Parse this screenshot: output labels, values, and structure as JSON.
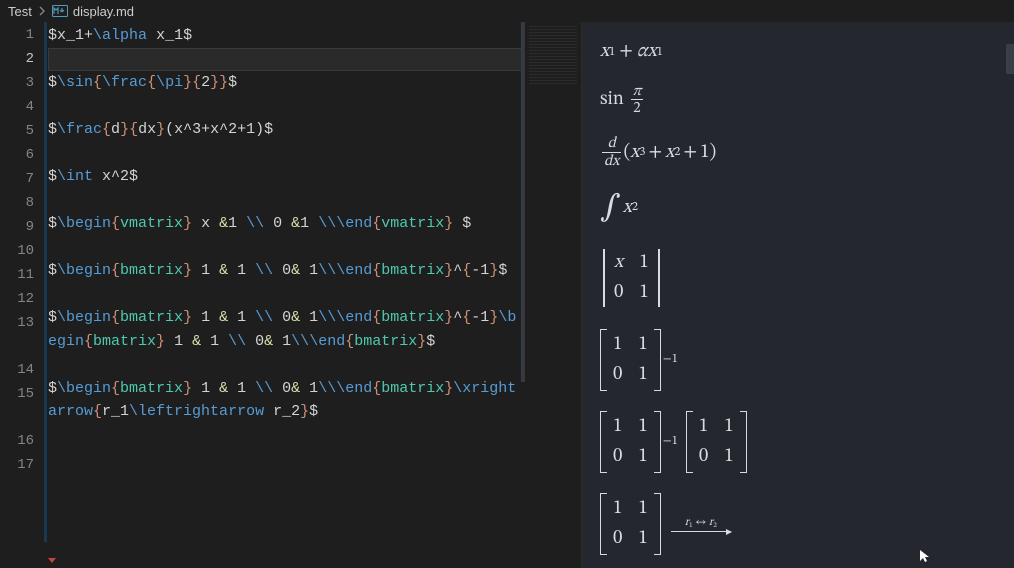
{
  "breadcrumb": {
    "root": "Test",
    "file": "display.md",
    "icon_name": "markdown-file-icon"
  },
  "editor": {
    "active_line": 2,
    "lines": [
      {
        "n": 1,
        "kind": "code",
        "segments": [
          {
            "t": "$",
            "c": "tk-white"
          },
          {
            "t": "x_1",
            "c": "tk-white"
          },
          {
            "t": "+",
            "c": "tk-white"
          },
          {
            "t": "\\alpha",
            "c": "tk-key"
          },
          {
            "t": " x_1",
            "c": "tk-white"
          },
          {
            "t": "$",
            "c": "tk-white"
          }
        ]
      },
      {
        "n": 2,
        "kind": "blank",
        "segments": []
      },
      {
        "n": 3,
        "kind": "code",
        "segments": [
          {
            "t": "$",
            "c": "tk-white"
          },
          {
            "t": "\\sin",
            "c": "tk-key"
          },
          {
            "t": "{",
            "c": "tk-orange"
          },
          {
            "t": "\\frac",
            "c": "tk-key"
          },
          {
            "t": "{",
            "c": "tk-orange"
          },
          {
            "t": "\\pi",
            "c": "tk-key"
          },
          {
            "t": "}{",
            "c": "tk-orange"
          },
          {
            "t": "2",
            "c": "tk-white"
          },
          {
            "t": "}}",
            "c": "tk-orange"
          },
          {
            "t": "$",
            "c": "tk-white"
          }
        ]
      },
      {
        "n": 4,
        "kind": "blank",
        "segments": []
      },
      {
        "n": 5,
        "kind": "code",
        "segments": [
          {
            "t": "$",
            "c": "tk-white"
          },
          {
            "t": "\\frac",
            "c": "tk-key"
          },
          {
            "t": "{",
            "c": "tk-orange"
          },
          {
            "t": "d",
            "c": "tk-white"
          },
          {
            "t": "}{",
            "c": "tk-orange"
          },
          {
            "t": "dx",
            "c": "tk-white"
          },
          {
            "t": "}",
            "c": "tk-orange"
          },
          {
            "t": "(x^3+x^2+1)",
            "c": "tk-white"
          },
          {
            "t": "$",
            "c": "tk-white"
          }
        ]
      },
      {
        "n": 6,
        "kind": "blank",
        "segments": []
      },
      {
        "n": 7,
        "kind": "code",
        "segments": [
          {
            "t": "$",
            "c": "tk-white"
          },
          {
            "t": "\\int",
            "c": "tk-key"
          },
          {
            "t": " x^2",
            "c": "tk-white"
          },
          {
            "t": "$",
            "c": "tk-white"
          }
        ]
      },
      {
        "n": 8,
        "kind": "blank",
        "segments": []
      },
      {
        "n": 9,
        "kind": "code",
        "segments": [
          {
            "t": "$",
            "c": "tk-white"
          },
          {
            "t": "\\begin",
            "c": "tk-key"
          },
          {
            "t": "{",
            "c": "tk-orange"
          },
          {
            "t": "vmatrix",
            "c": "tk-green"
          },
          {
            "t": "}",
            "c": "tk-orange"
          },
          {
            "t": " x ",
            "c": "tk-white"
          },
          {
            "t": "&",
            "c": "tk-yellow"
          },
          {
            "t": "1 ",
            "c": "tk-white"
          },
          {
            "t": "\\\\",
            "c": "tk-key"
          },
          {
            "t": " 0 ",
            "c": "tk-white"
          },
          {
            "t": "&",
            "c": "tk-yellow"
          },
          {
            "t": "1 ",
            "c": "tk-white"
          },
          {
            "t": "\\\\",
            "c": "tk-key"
          },
          {
            "t": "\\end",
            "c": "tk-key"
          },
          {
            "t": "{",
            "c": "tk-orange"
          },
          {
            "t": "vmatrix",
            "c": "tk-green"
          },
          {
            "t": "}",
            "c": "tk-orange"
          },
          {
            "t": " $",
            "c": "tk-white"
          }
        ]
      },
      {
        "n": 10,
        "kind": "blank",
        "segments": []
      },
      {
        "n": 11,
        "kind": "code",
        "segments": [
          {
            "t": "$",
            "c": "tk-white"
          },
          {
            "t": "\\begin",
            "c": "tk-key"
          },
          {
            "t": "{",
            "c": "tk-orange"
          },
          {
            "t": "bmatrix",
            "c": "tk-green"
          },
          {
            "t": "}",
            "c": "tk-orange"
          },
          {
            "t": " 1 ",
            "c": "tk-white"
          },
          {
            "t": "&",
            "c": "tk-yellow"
          },
          {
            "t": " 1 ",
            "c": "tk-white"
          },
          {
            "t": "\\\\",
            "c": "tk-key"
          },
          {
            "t": " 0",
            "c": "tk-white"
          },
          {
            "t": "&",
            "c": "tk-yellow"
          },
          {
            "t": " 1",
            "c": "tk-white"
          },
          {
            "t": "\\\\",
            "c": "tk-key"
          },
          {
            "t": "\\end",
            "c": "tk-key"
          },
          {
            "t": "{",
            "c": "tk-orange"
          },
          {
            "t": "bmatrix",
            "c": "tk-green"
          },
          {
            "t": "}",
            "c": "tk-orange"
          },
          {
            "t": "^",
            "c": "tk-white"
          },
          {
            "t": "{",
            "c": "tk-orange"
          },
          {
            "t": "-1",
            "c": "tk-white"
          },
          {
            "t": "}",
            "c": "tk-orange"
          },
          {
            "t": "$",
            "c": "tk-white"
          }
        ]
      },
      {
        "n": 12,
        "kind": "blank",
        "segments": []
      },
      {
        "n": 13,
        "kind": "code",
        "segments": [
          {
            "t": "$",
            "c": "tk-white"
          },
          {
            "t": "\\begin",
            "c": "tk-key"
          },
          {
            "t": "{",
            "c": "tk-orange"
          },
          {
            "t": "bmatrix",
            "c": "tk-green"
          },
          {
            "t": "}",
            "c": "tk-orange"
          },
          {
            "t": " 1 ",
            "c": "tk-white"
          },
          {
            "t": "&",
            "c": "tk-yellow"
          },
          {
            "t": " 1 ",
            "c": "tk-white"
          },
          {
            "t": "\\\\",
            "c": "tk-key"
          },
          {
            "t": " 0",
            "c": "tk-white"
          },
          {
            "t": "&",
            "c": "tk-yellow"
          },
          {
            "t": " 1",
            "c": "tk-white"
          },
          {
            "t": "\\\\",
            "c": "tk-key"
          },
          {
            "t": "\\end",
            "c": "tk-key"
          },
          {
            "t": "{",
            "c": "tk-orange"
          },
          {
            "t": "bmatrix",
            "c": "tk-green"
          },
          {
            "t": "}",
            "c": "tk-orange"
          },
          {
            "t": "^",
            "c": "tk-white"
          },
          {
            "t": "{",
            "c": "tk-orange"
          },
          {
            "t": "-1",
            "c": "tk-white"
          },
          {
            "t": "}",
            "c": "tk-orange"
          },
          {
            "t": "\\begin",
            "c": "tk-key"
          },
          {
            "t": "{",
            "c": "tk-orange"
          },
          {
            "t": "bmatrix",
            "c": "tk-green"
          },
          {
            "t": "}",
            "c": "tk-orange"
          },
          {
            "t": " 1 ",
            "c": "tk-white"
          },
          {
            "t": "&",
            "c": "tk-yellow"
          },
          {
            "t": " 1 ",
            "c": "tk-white"
          },
          {
            "t": "\\\\",
            "c": "tk-key"
          },
          {
            "t": " 0",
            "c": "tk-white"
          },
          {
            "t": "&",
            "c": "tk-yellow"
          },
          {
            "t": " 1",
            "c": "tk-white"
          },
          {
            "t": "\\\\",
            "c": "tk-key"
          },
          {
            "t": "\\end",
            "c": "tk-key"
          },
          {
            "t": "{",
            "c": "tk-orange"
          },
          {
            "t": "bmatrix",
            "c": "tk-green"
          },
          {
            "t": "}",
            "c": "tk-orange"
          },
          {
            "t": "$",
            "c": "tk-white"
          }
        ]
      },
      {
        "n": 14,
        "kind": "blank",
        "segments": []
      },
      {
        "n": 15,
        "kind": "code",
        "segments": [
          {
            "t": "$",
            "c": "tk-white"
          },
          {
            "t": "\\begin",
            "c": "tk-key"
          },
          {
            "t": "{",
            "c": "tk-orange"
          },
          {
            "t": "bmatrix",
            "c": "tk-green"
          },
          {
            "t": "}",
            "c": "tk-orange"
          },
          {
            "t": " 1 ",
            "c": "tk-white"
          },
          {
            "t": "&",
            "c": "tk-yellow"
          },
          {
            "t": " 1 ",
            "c": "tk-white"
          },
          {
            "t": "\\\\",
            "c": "tk-key"
          },
          {
            "t": " 0",
            "c": "tk-white"
          },
          {
            "t": "&",
            "c": "tk-yellow"
          },
          {
            "t": " 1",
            "c": "tk-white"
          },
          {
            "t": "\\\\",
            "c": "tk-key"
          },
          {
            "t": "\\end",
            "c": "tk-key"
          },
          {
            "t": "{",
            "c": "tk-orange"
          },
          {
            "t": "bmatrix",
            "c": "tk-green"
          },
          {
            "t": "}",
            "c": "tk-orange"
          },
          {
            "t": "\\xrightarrow",
            "c": "tk-key"
          },
          {
            "t": "{",
            "c": "tk-orange"
          },
          {
            "t": "r_1",
            "c": "tk-white"
          },
          {
            "t": "\\leftrightarrow",
            "c": "tk-key"
          },
          {
            "t": " r_2",
            "c": "tk-white"
          },
          {
            "t": "}",
            "c": "tk-orange"
          },
          {
            "t": "$",
            "c": "tk-white"
          }
        ]
      },
      {
        "n": 16,
        "kind": "blank",
        "segments": []
      },
      {
        "n": 17,
        "kind": "blank",
        "segments": []
      }
    ],
    "wrap_widths": {
      "9": 46,
      "11": 46,
      "13": 46,
      "15": 46
    }
  },
  "preview": {
    "eq1": {
      "var": "x",
      "sub1": "1",
      "plus": "+",
      "alpha": "α",
      "sub2": "1"
    },
    "eq2": {
      "fn": "sin",
      "num": "π",
      "den": "2"
    },
    "eq3": {
      "dnum": "d",
      "dden": "dx",
      "lp": "(",
      "body_x": "x",
      "p3": "3",
      "plus1": "+",
      "p2": "2",
      "one": "1",
      "rp": ")"
    },
    "eq4": {
      "int": "∫",
      "var": "x",
      "pow": "2"
    },
    "vmat": {
      "a": "x",
      "b": "1",
      "c": "0",
      "d": "1"
    },
    "bmat1": {
      "a": "1",
      "b": "1",
      "c": "0",
      "d": "1",
      "exp": "−1"
    },
    "bmat2": {
      "a": "1",
      "b": "1",
      "c": "0",
      "d": "1",
      "exp": "−1",
      "e": "1",
      "f": "1",
      "g": "0",
      "h": "1"
    },
    "bmat3": {
      "a": "1",
      "b": "1",
      "c": "0",
      "d": "1",
      "label_r1": "r",
      "s1": "1",
      "arr": "↔",
      "label_r2": "r",
      "s2": "2"
    }
  }
}
